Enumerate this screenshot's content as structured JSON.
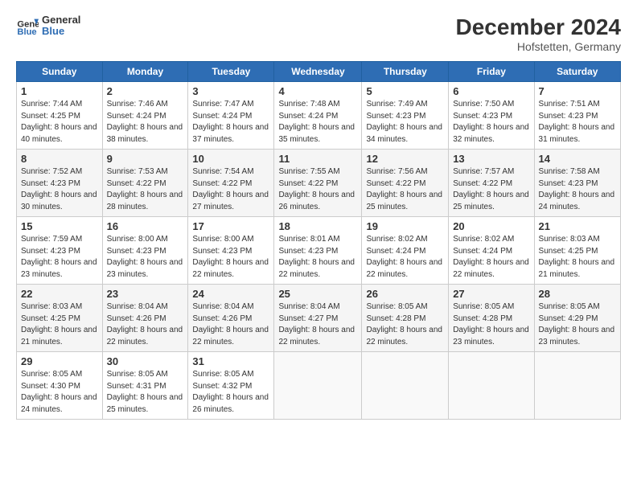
{
  "header": {
    "logo_line1": "General",
    "logo_line2": "Blue",
    "month": "December 2024",
    "location": "Hofstetten, Germany"
  },
  "weekdays": [
    "Sunday",
    "Monday",
    "Tuesday",
    "Wednesday",
    "Thursday",
    "Friday",
    "Saturday"
  ],
  "weeks": [
    [
      {
        "day": "1",
        "sunrise": "7:44 AM",
        "sunset": "4:25 PM",
        "daylight": "8 hours and 40 minutes."
      },
      {
        "day": "2",
        "sunrise": "7:46 AM",
        "sunset": "4:24 PM",
        "daylight": "8 hours and 38 minutes."
      },
      {
        "day": "3",
        "sunrise": "7:47 AM",
        "sunset": "4:24 PM",
        "daylight": "8 hours and 37 minutes."
      },
      {
        "day": "4",
        "sunrise": "7:48 AM",
        "sunset": "4:24 PM",
        "daylight": "8 hours and 35 minutes."
      },
      {
        "day": "5",
        "sunrise": "7:49 AM",
        "sunset": "4:23 PM",
        "daylight": "8 hours and 34 minutes."
      },
      {
        "day": "6",
        "sunrise": "7:50 AM",
        "sunset": "4:23 PM",
        "daylight": "8 hours and 32 minutes."
      },
      {
        "day": "7",
        "sunrise": "7:51 AM",
        "sunset": "4:23 PM",
        "daylight": "8 hours and 31 minutes."
      }
    ],
    [
      {
        "day": "8",
        "sunrise": "7:52 AM",
        "sunset": "4:23 PM",
        "daylight": "8 hours and 30 minutes."
      },
      {
        "day": "9",
        "sunrise": "7:53 AM",
        "sunset": "4:22 PM",
        "daylight": "8 hours and 28 minutes."
      },
      {
        "day": "10",
        "sunrise": "7:54 AM",
        "sunset": "4:22 PM",
        "daylight": "8 hours and 27 minutes."
      },
      {
        "day": "11",
        "sunrise": "7:55 AM",
        "sunset": "4:22 PM",
        "daylight": "8 hours and 26 minutes."
      },
      {
        "day": "12",
        "sunrise": "7:56 AM",
        "sunset": "4:22 PM",
        "daylight": "8 hours and 25 minutes."
      },
      {
        "day": "13",
        "sunrise": "7:57 AM",
        "sunset": "4:22 PM",
        "daylight": "8 hours and 25 minutes."
      },
      {
        "day": "14",
        "sunrise": "7:58 AM",
        "sunset": "4:23 PM",
        "daylight": "8 hours and 24 minutes."
      }
    ],
    [
      {
        "day": "15",
        "sunrise": "7:59 AM",
        "sunset": "4:23 PM",
        "daylight": "8 hours and 23 minutes."
      },
      {
        "day": "16",
        "sunrise": "8:00 AM",
        "sunset": "4:23 PM",
        "daylight": "8 hours and 23 minutes."
      },
      {
        "day": "17",
        "sunrise": "8:00 AM",
        "sunset": "4:23 PM",
        "daylight": "8 hours and 22 minutes."
      },
      {
        "day": "18",
        "sunrise": "8:01 AM",
        "sunset": "4:23 PM",
        "daylight": "8 hours and 22 minutes."
      },
      {
        "day": "19",
        "sunrise": "8:02 AM",
        "sunset": "4:24 PM",
        "daylight": "8 hours and 22 minutes."
      },
      {
        "day": "20",
        "sunrise": "8:02 AM",
        "sunset": "4:24 PM",
        "daylight": "8 hours and 22 minutes."
      },
      {
        "day": "21",
        "sunrise": "8:03 AM",
        "sunset": "4:25 PM",
        "daylight": "8 hours and 21 minutes."
      }
    ],
    [
      {
        "day": "22",
        "sunrise": "8:03 AM",
        "sunset": "4:25 PM",
        "daylight": "8 hours and 21 minutes."
      },
      {
        "day": "23",
        "sunrise": "8:04 AM",
        "sunset": "4:26 PM",
        "daylight": "8 hours and 22 minutes."
      },
      {
        "day": "24",
        "sunrise": "8:04 AM",
        "sunset": "4:26 PM",
        "daylight": "8 hours and 22 minutes."
      },
      {
        "day": "25",
        "sunrise": "8:04 AM",
        "sunset": "4:27 PM",
        "daylight": "8 hours and 22 minutes."
      },
      {
        "day": "26",
        "sunrise": "8:05 AM",
        "sunset": "4:28 PM",
        "daylight": "8 hours and 22 minutes."
      },
      {
        "day": "27",
        "sunrise": "8:05 AM",
        "sunset": "4:28 PM",
        "daylight": "8 hours and 23 minutes."
      },
      {
        "day": "28",
        "sunrise": "8:05 AM",
        "sunset": "4:29 PM",
        "daylight": "8 hours and 23 minutes."
      }
    ],
    [
      {
        "day": "29",
        "sunrise": "8:05 AM",
        "sunset": "4:30 PM",
        "daylight": "8 hours and 24 minutes."
      },
      {
        "day": "30",
        "sunrise": "8:05 AM",
        "sunset": "4:31 PM",
        "daylight": "8 hours and 25 minutes."
      },
      {
        "day": "31",
        "sunrise": "8:05 AM",
        "sunset": "4:32 PM",
        "daylight": "8 hours and 26 minutes."
      },
      null,
      null,
      null,
      null
    ]
  ]
}
